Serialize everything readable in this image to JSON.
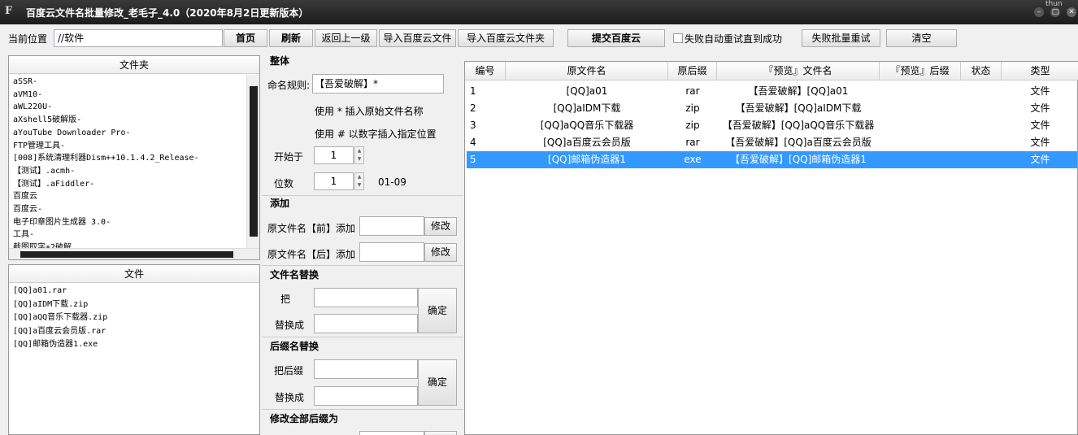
{
  "window": {
    "title": "百度云文件名批量修改_老毛子_4.0（2020年8月2日更新版本）",
    "icon": "F",
    "tray_text": "thun"
  },
  "toolbar": {
    "location_label": "当前位置",
    "location_value": "//软件",
    "home": "首页",
    "refresh": "刷新",
    "back": "返回上一级",
    "import_file": "导入百度云文件",
    "import_folder": "导入百度云文件夹",
    "submit": "提交百度云",
    "auto_retry": "失败自动重试直到成功",
    "batch_retry": "失败批量重试",
    "clear": "清空"
  },
  "folder_panel": {
    "header": "文件夹",
    "items": [
      "aSSR-",
      "aVM10-",
      "aWL220U-",
      "aXshell5破解版-",
      "aYouTube Downloader Pro-",
      "FTP管理工具-",
      "[008]系统清理利器Dism++10.1.4.2_Release-",
      "【测试】.acmh-",
      "【测试】.aFiddler-",
      "百度云",
      "百度云-",
      "电子印章图片生成器 3.0-",
      "工具-",
      "截图取字+2破解"
    ]
  },
  "file_panel": {
    "header": "文件",
    "items": [
      "[QQ]a01.rar",
      "[QQ]aIDM下载.zip",
      "[QQ]aQQ音乐下载器.zip",
      "[QQ]a百度云会员版.rar",
      "[QQ]邮箱伪造器1.exe"
    ]
  },
  "overall": {
    "title": "整体",
    "rule_label": "命名规则:",
    "rule_value": "【吾爱破解】*",
    "hint1": "使用 * 插入原始文件名称",
    "hint2": "使用 # 以数字插入指定位置",
    "start_label": "开始于",
    "start_value": "1",
    "digits_label": "位数",
    "digits_value": "1",
    "digits_range": "01-09"
  },
  "add": {
    "title": "添加",
    "before_label": "原文件名【前】添加",
    "after_label": "原文件名【后】添加",
    "modify": "修改"
  },
  "replace": {
    "title": "文件名替换",
    "from_label": "把",
    "to_label": "替换成",
    "confirm": "确定"
  },
  "ext_replace": {
    "title": "后缀名替换",
    "from_label": "把后缀",
    "to_label": "替换成",
    "confirm": "确定"
  },
  "modify_all_ext": {
    "title": "修改全部后缀为"
  },
  "grid": {
    "columns": [
      "编号",
      "原文件名",
      "原后缀",
      "『预览』文件名",
      "『预览』后缀",
      "状态",
      "类型"
    ],
    "rows": [
      {
        "id": "1",
        "name": "[QQ]a01",
        "ext": "rar",
        "preview": "【吾爱破解】[QQ]a01",
        "pext": "",
        "status": "",
        "type": "文件"
      },
      {
        "id": "2",
        "name": "[QQ]aIDM下载",
        "ext": "zip",
        "preview": "【吾爱破解】[QQ]aIDM下载",
        "pext": "",
        "status": "",
        "type": "文件"
      },
      {
        "id": "3",
        "name": "[QQ]aQQ音乐下载器",
        "ext": "zip",
        "preview": "【吾爱破解】[QQ]aQQ音乐下载器",
        "pext": "",
        "status": "",
        "type": "文件"
      },
      {
        "id": "4",
        "name": "[QQ]a百度云会员版",
        "ext": "rar",
        "preview": "【吾爱破解】[QQ]a百度云会员版",
        "pext": "",
        "status": "",
        "type": "文件"
      },
      {
        "id": "5",
        "name": "[QQ]邮箱伪造器1",
        "ext": "exe",
        "preview": "【吾爱破解】[QQ]邮箱伪造器1",
        "pext": "",
        "status": "",
        "type": "文件"
      }
    ],
    "selected_row": "5"
  },
  "colors": {
    "selection": "#3399ff",
    "title_bar": "#2a2a2a",
    "client_bg": "#f0f0f0"
  }
}
